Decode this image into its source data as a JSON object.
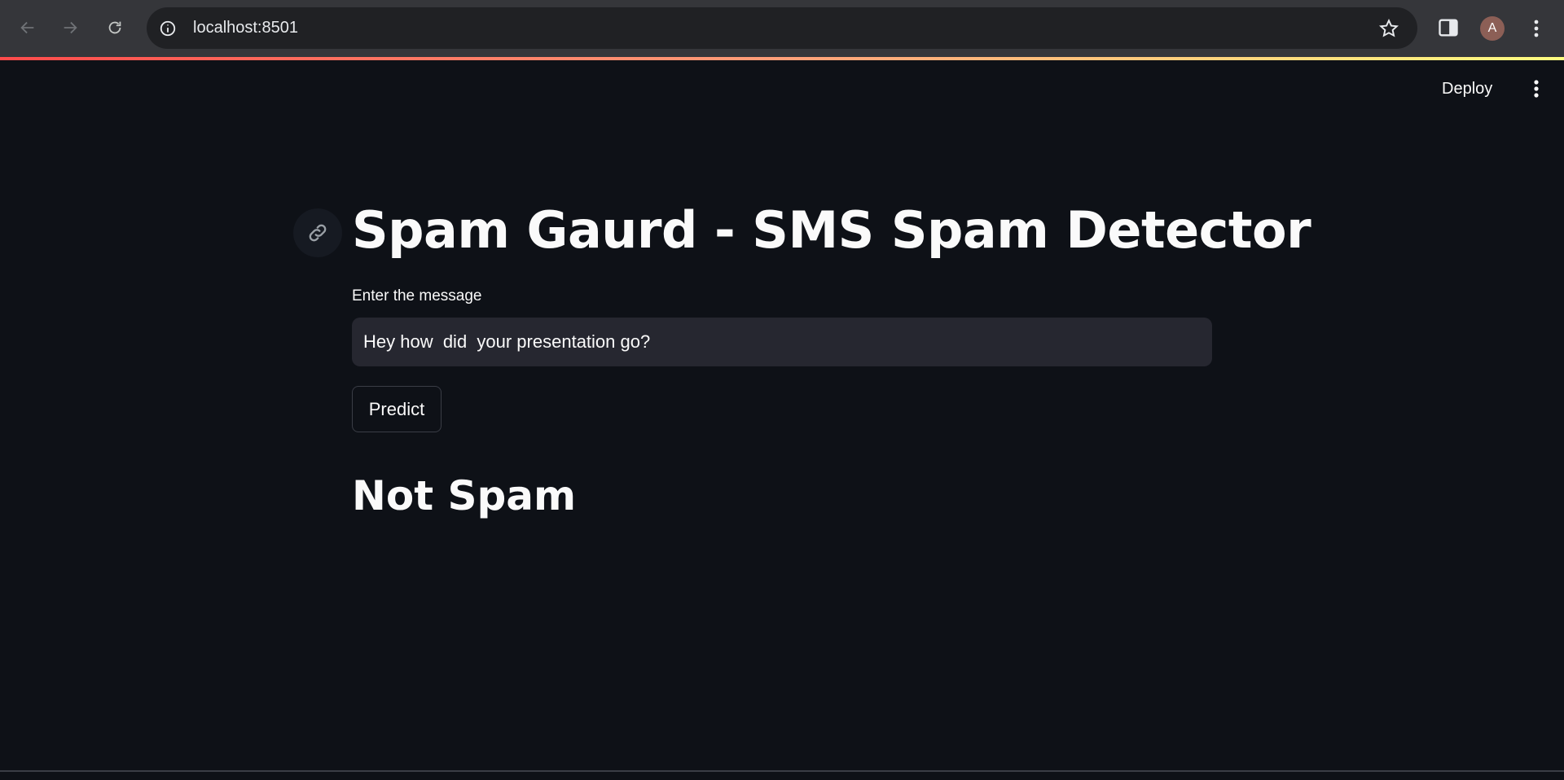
{
  "browser": {
    "url": "localhost:8501",
    "avatar_letter": "A",
    "icons": {
      "back": "arrow-left-icon",
      "forward": "arrow-right-icon",
      "reload": "reload-icon",
      "site_info": "info-icon",
      "bookmark": "star-icon",
      "side_panel": "side-panel-icon",
      "menu": "kebab-menu-icon"
    }
  },
  "app_header": {
    "deploy_label": "Deploy",
    "menu_icon": "kebab-menu-icon"
  },
  "main": {
    "title": "Spam Gaurd - SMS Spam Detector",
    "anchor_icon": "link-icon",
    "input_label": "Enter the message",
    "input_value": "Hey how  did  your presentation go?",
    "predict_label": "Predict",
    "result": "Not Spam"
  },
  "colors": {
    "background": "#0e1117",
    "input_bg": "#262730",
    "accent_gradient_start": "#ff4b4b",
    "accent_gradient_end": "#fffd80"
  }
}
